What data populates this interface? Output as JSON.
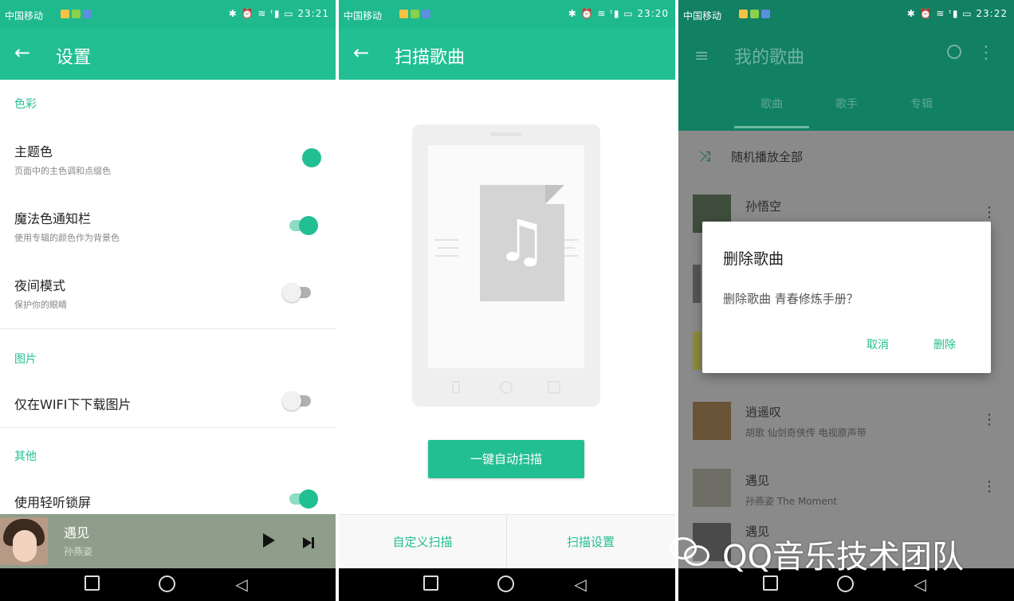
{
  "statusbar": {
    "carrier": "中国移动",
    "icons_right": "✱ ⏰ ≋ ᵗ▮ ▭",
    "time_1": "23:21",
    "time_2": "23:20",
    "time_3": "23:22"
  },
  "nav": {
    "home_icon": "square-icon",
    "circle_icon": "circle-icon",
    "back_glyph": "◁"
  },
  "settings": {
    "back_glyph": "←",
    "title": "设置",
    "sections": {
      "color": "色彩",
      "image": "图片",
      "other": "其他"
    },
    "rows": {
      "theme": {
        "title": "主题色",
        "sub": "页面中的主色调和点缀色"
      },
      "magic": {
        "title": "魔法色通知栏",
        "sub": "使用专辑的颜色作为背景色",
        "on": true
      },
      "night": {
        "title": "夜间模式",
        "sub": "保护你的眼睛",
        "on": false
      },
      "wifi": {
        "title": "仅在WIFI下下载图片",
        "on": false
      },
      "lock": {
        "title": "使用轻听锁屏",
        "on": true
      }
    },
    "player": {
      "title": "遇见",
      "artist": "孙燕姿"
    }
  },
  "scan": {
    "back_glyph": "←",
    "title": "扫描歌曲",
    "button": "一键自动扫描",
    "custom_scan": "自定义扫描",
    "scan_settings": "扫描设置",
    "note_glyph": "♫"
  },
  "mysongs": {
    "menu_glyph": "≡",
    "title": "我的歌曲",
    "more_glyph": "⋮",
    "tabs": [
      "歌曲",
      "歌手",
      "专辑"
    ],
    "shuffle_glyph": "⤨",
    "shuffle_all": "随机播放全部",
    "songs": [
      {
        "title": "孙悟空",
        "sub": ""
      },
      {
        "title": "逍遥叹",
        "sub": "胡歌   仙剑奇侠传 电视原声带"
      },
      {
        "title": "遇见",
        "sub": "孙燕姿   The Moment"
      },
      {
        "title": "遇见",
        "sub": ""
      }
    ],
    "dialog": {
      "title": "删除歌曲",
      "message": "删除歌曲 青春修炼手册？",
      "cancel": "取消",
      "delete": "删除"
    }
  },
  "watermark": "QQ音乐技术团队",
  "colors": {
    "accent": "#22bf92",
    "status": "#1fb98e",
    "dim_toolbar": "#118063"
  }
}
